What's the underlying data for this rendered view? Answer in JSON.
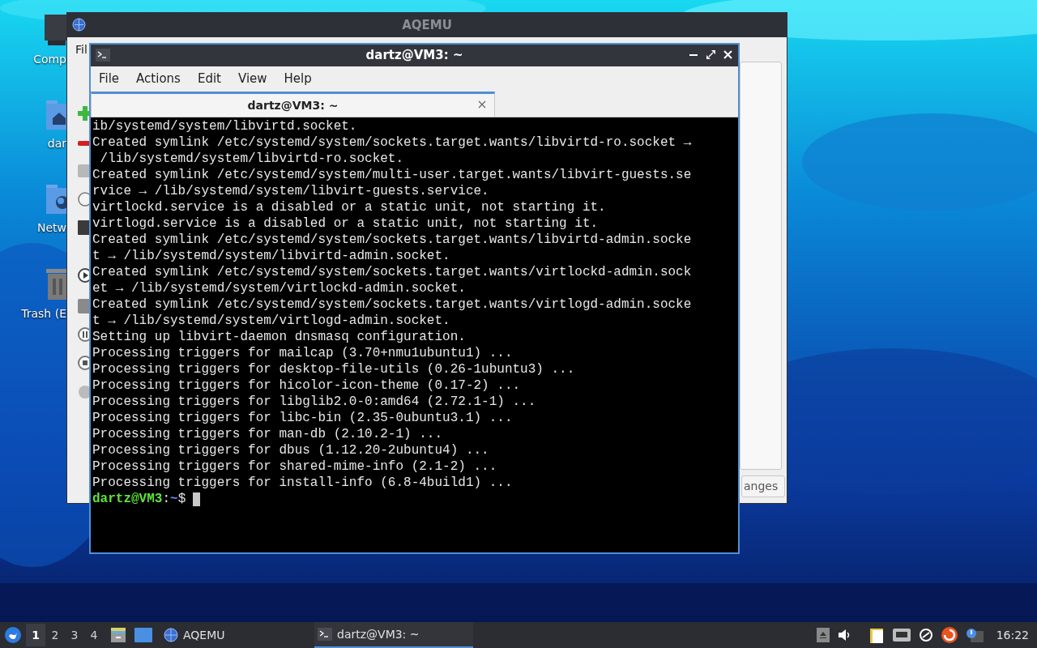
{
  "desktop_icons": [
    {
      "kind": "computer",
      "label": "Comp"
    },
    {
      "kind": "home",
      "label": "dar"
    },
    {
      "kind": "network",
      "label": "Netw"
    },
    {
      "kind": "trash",
      "label": "Trash (E"
    }
  ],
  "aqemu_window": {
    "title": "AQEMU",
    "menu": [
      "Fil"
    ],
    "button": "anges"
  },
  "terminal_window": {
    "title": "dartz@VM3: ~",
    "menus": [
      "File",
      "Actions",
      "Edit",
      "View",
      "Help"
    ],
    "tabs": [
      {
        "label": "dartz@VM3: ~",
        "selected": true
      }
    ],
    "lines": [
      "ib/systemd/system/libvirtd.socket.",
      "Created symlink /etc/systemd/system/sockets.target.wants/libvirtd-ro.socket →",
      " /lib/systemd/system/libvirtd-ro.socket.",
      "Created symlink /etc/systemd/system/multi-user.target.wants/libvirt-guests.se",
      "rvice → /lib/systemd/system/libvirt-guests.service.",
      "virtlockd.service is a disabled or a static unit, not starting it.",
      "virtlogd.service is a disabled or a static unit, not starting it.",
      "Created symlink /etc/systemd/system/sockets.target.wants/libvirtd-admin.socke",
      "t → /lib/systemd/system/libvirtd-admin.socket.",
      "Created symlink /etc/systemd/system/sockets.target.wants/virtlockd-admin.sock",
      "et → /lib/systemd/system/virtlockd-admin.socket.",
      "Created symlink /etc/systemd/system/sockets.target.wants/virtlogd-admin.socke",
      "t → /lib/systemd/system/virtlogd-admin.socket.",
      "Setting up libvirt-daemon dnsmasq configuration.",
      "Processing triggers for mailcap (3.70+nmu1ubuntu1) ...",
      "Processing triggers for desktop-file-utils (0.26-1ubuntu3) ...",
      "Processing triggers for hicolor-icon-theme (0.17-2) ...",
      "Processing triggers for libglib2.0-0:amd64 (2.72.1-1) ...",
      "Processing triggers for libc-bin (2.35-0ubuntu3.1) ...",
      "Processing triggers for man-db (2.10.2-1) ...",
      "Processing triggers for dbus (1.12.20-2ubuntu4) ...",
      "Processing triggers for shared-mime-info (2.1-2) ...",
      "Processing triggers for install-info (6.8-4build1) ..."
    ],
    "prompt": {
      "user_host": "dartz@VM3",
      "separator": ":",
      "path": "~",
      "symbol": "$"
    }
  },
  "taskbar": {
    "workspaces": [
      {
        "label": "1",
        "selected": true
      },
      {
        "label": "2",
        "selected": false
      },
      {
        "label": "3",
        "selected": false
      },
      {
        "label": "4",
        "selected": false
      }
    ],
    "tasks": [
      {
        "kind": "globe",
        "label": "AQEMU",
        "selected": false
      },
      {
        "kind": "terminal",
        "label": "dartz@VM3: ~",
        "selected": true
      }
    ],
    "clock": "16:22"
  }
}
